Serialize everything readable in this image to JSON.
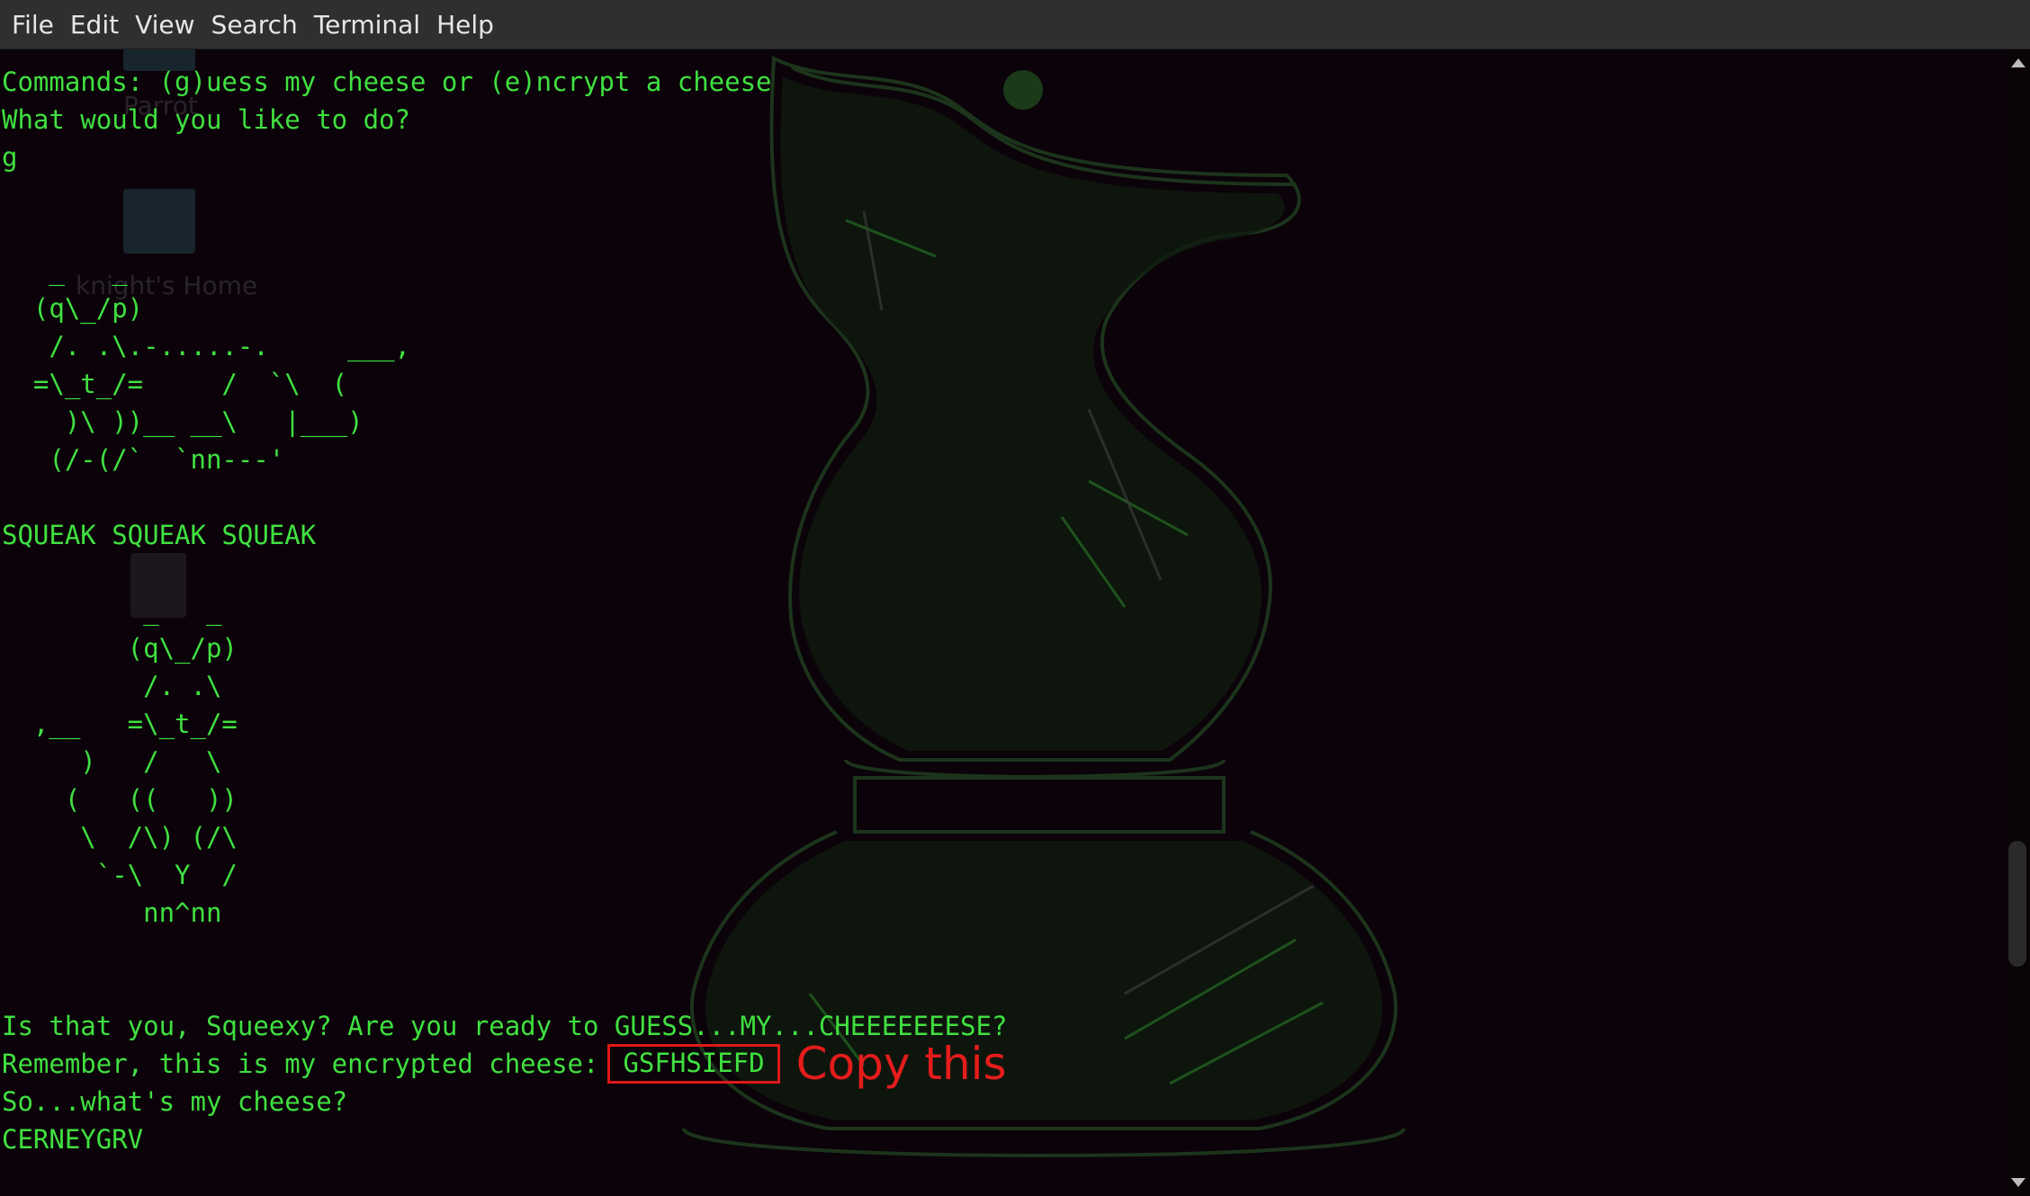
{
  "menu": {
    "file": "File",
    "edit": "Edit",
    "view": "View",
    "search": "Search",
    "terminal": "Terminal",
    "help": "Help"
  },
  "desktop_ghost": {
    "label_top": "Parrot",
    "label_home": "knight's Home"
  },
  "terminal": {
    "lines": [
      "Commands: (g)uess my cheese or (e)ncrypt a cheese",
      "What would you like to do?",
      "g",
      "",
      "",
      "   _   _",
      "  (q\\_/p)",
      "   /. .\\.-.....-.     ___,",
      "  =\\_t_/=     /  `\\  (",
      "    )\\ ))__ __\\   |___)",
      "   (/-(/`  `nn---'",
      "",
      "SQUEAK SQUEAK SQUEAK",
      "",
      "         _   _",
      "        (q\\_/p)",
      "         /. .\\",
      "  ,__   =\\_t_/=",
      "     )   /   \\",
      "    (   ((   ))",
      "     \\  /\\) (/\\",
      "      `-\\  Y  /",
      "         nn^nn",
      "",
      "",
      "Is that you, Squeexy? Are you ready to GUESS...MY...CHEEEEEEESE?",
      "Remember, this is my encrypted cheese:",
      "So...what's my cheese?",
      "CERNEYGRV"
    ],
    "encrypted_cheese": "GSFHSIEFD",
    "annotation": "Copy this"
  },
  "colors": {
    "terminal_text": "#40e040",
    "terminal_bg": "#0b0309",
    "menubar_bg": "#2f2f2f",
    "highlight": "#e01818"
  }
}
